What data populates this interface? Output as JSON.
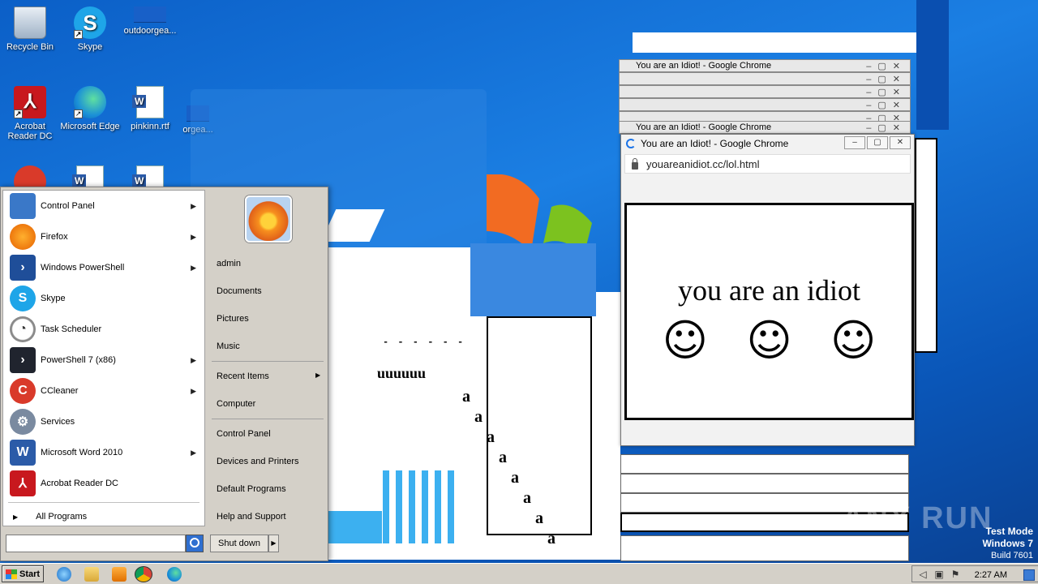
{
  "desktop": {
    "icons": [
      {
        "label": "Recycle Bin"
      },
      {
        "label": "Skype"
      },
      {
        "label": "outdoorgea..."
      },
      {
        "label": "Acrobat Reader DC"
      },
      {
        "label": "Microsoft Edge"
      },
      {
        "label": "pinkinn.rtf"
      },
      {
        "label": "orgea..."
      }
    ]
  },
  "chrome": {
    "stack_title": "You are an Idiot! - Google Chrome",
    "main_window": {
      "title": "You are an Idiot! - Google Chrome",
      "url": "youareanidiot.cc/lol.html",
      "page_text": "you are an idiot",
      "smileys": [
        "☺",
        "☺",
        "☺"
      ]
    }
  },
  "artifacts": {
    "glyph": "a",
    "dash_row": "- - - - - -",
    "u_row": "uuuuuu"
  },
  "start_menu": {
    "programs": [
      {
        "label": "Control Panel",
        "icon": "control-panel-icon",
        "color": "#3a78c8",
        "submenu": true
      },
      {
        "label": "Firefox",
        "icon": "firefox-icon",
        "color": "#e66000",
        "submenu": true
      },
      {
        "label": "Windows PowerShell",
        "icon": "powershell-icon",
        "color": "#1f4e99",
        "submenu": true
      },
      {
        "label": "Skype",
        "icon": "skype-icon",
        "color": "#1ea5e8",
        "submenu": false
      },
      {
        "label": "Task Scheduler",
        "icon": "clock-icon",
        "color": "#8a8a8a",
        "submenu": false
      },
      {
        "label": "PowerShell 7 (x86)",
        "icon": "powershell7-icon",
        "color": "#20242e",
        "submenu": true
      },
      {
        "label": "CCleaner",
        "icon": "ccleaner-icon",
        "color": "#d93a2a",
        "submenu": true
      },
      {
        "label": "Services",
        "icon": "gears-icon",
        "color": "#7a8aa0",
        "submenu": false
      },
      {
        "label": "Microsoft Word 2010",
        "icon": "word-icon",
        "color": "#2b5ba8",
        "submenu": true
      },
      {
        "label": "Acrobat Reader DC",
        "icon": "acrobat-icon",
        "color": "#c8181e",
        "submenu": false
      }
    ],
    "all_programs": "All Programs",
    "right": {
      "user": "admin",
      "documents": "Documents",
      "pictures": "Pictures",
      "music": "Music",
      "recent_items": "Recent Items",
      "computer": "Computer",
      "control_panel": "Control Panel",
      "devices_printers": "Devices and Printers",
      "default_programs": "Default Programs",
      "help_support": "Help and Support"
    },
    "search_placeholder": "",
    "shutdown": "Shut down"
  },
  "taskbar": {
    "start": "Start",
    "clock": "2:27 AM"
  },
  "watermark": "ANY RUN",
  "test_mode": {
    "line1": "Test Mode",
    "line2": "Windows 7",
    "line3": "Build 7601"
  }
}
